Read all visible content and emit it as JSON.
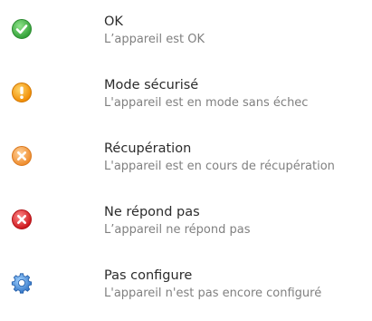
{
  "statuses": [
    {
      "icon": "check-circle-icon",
      "color": "#4caf50",
      "title": "OK",
      "description": "L’appareil est OK"
    },
    {
      "icon": "exclamation-circle-icon",
      "color": "#f5a000",
      "title": "Mode sécurisé",
      "description": "L'appareil est en mode sans échec"
    },
    {
      "icon": "x-circle-icon",
      "color": "#f5a34a",
      "title": "Récupération",
      "description": "L'appareil est en cours de récupération"
    },
    {
      "icon": "x-circle-icon",
      "color": "#e0262b",
      "title": "Ne répond pas",
      "description": "L’appareil ne répond pas"
    },
    {
      "icon": "gear-icon",
      "color": "#3b7fd0",
      "title": "Pas configure",
      "description": "L'appareil n'est pas encore configuré"
    }
  ]
}
